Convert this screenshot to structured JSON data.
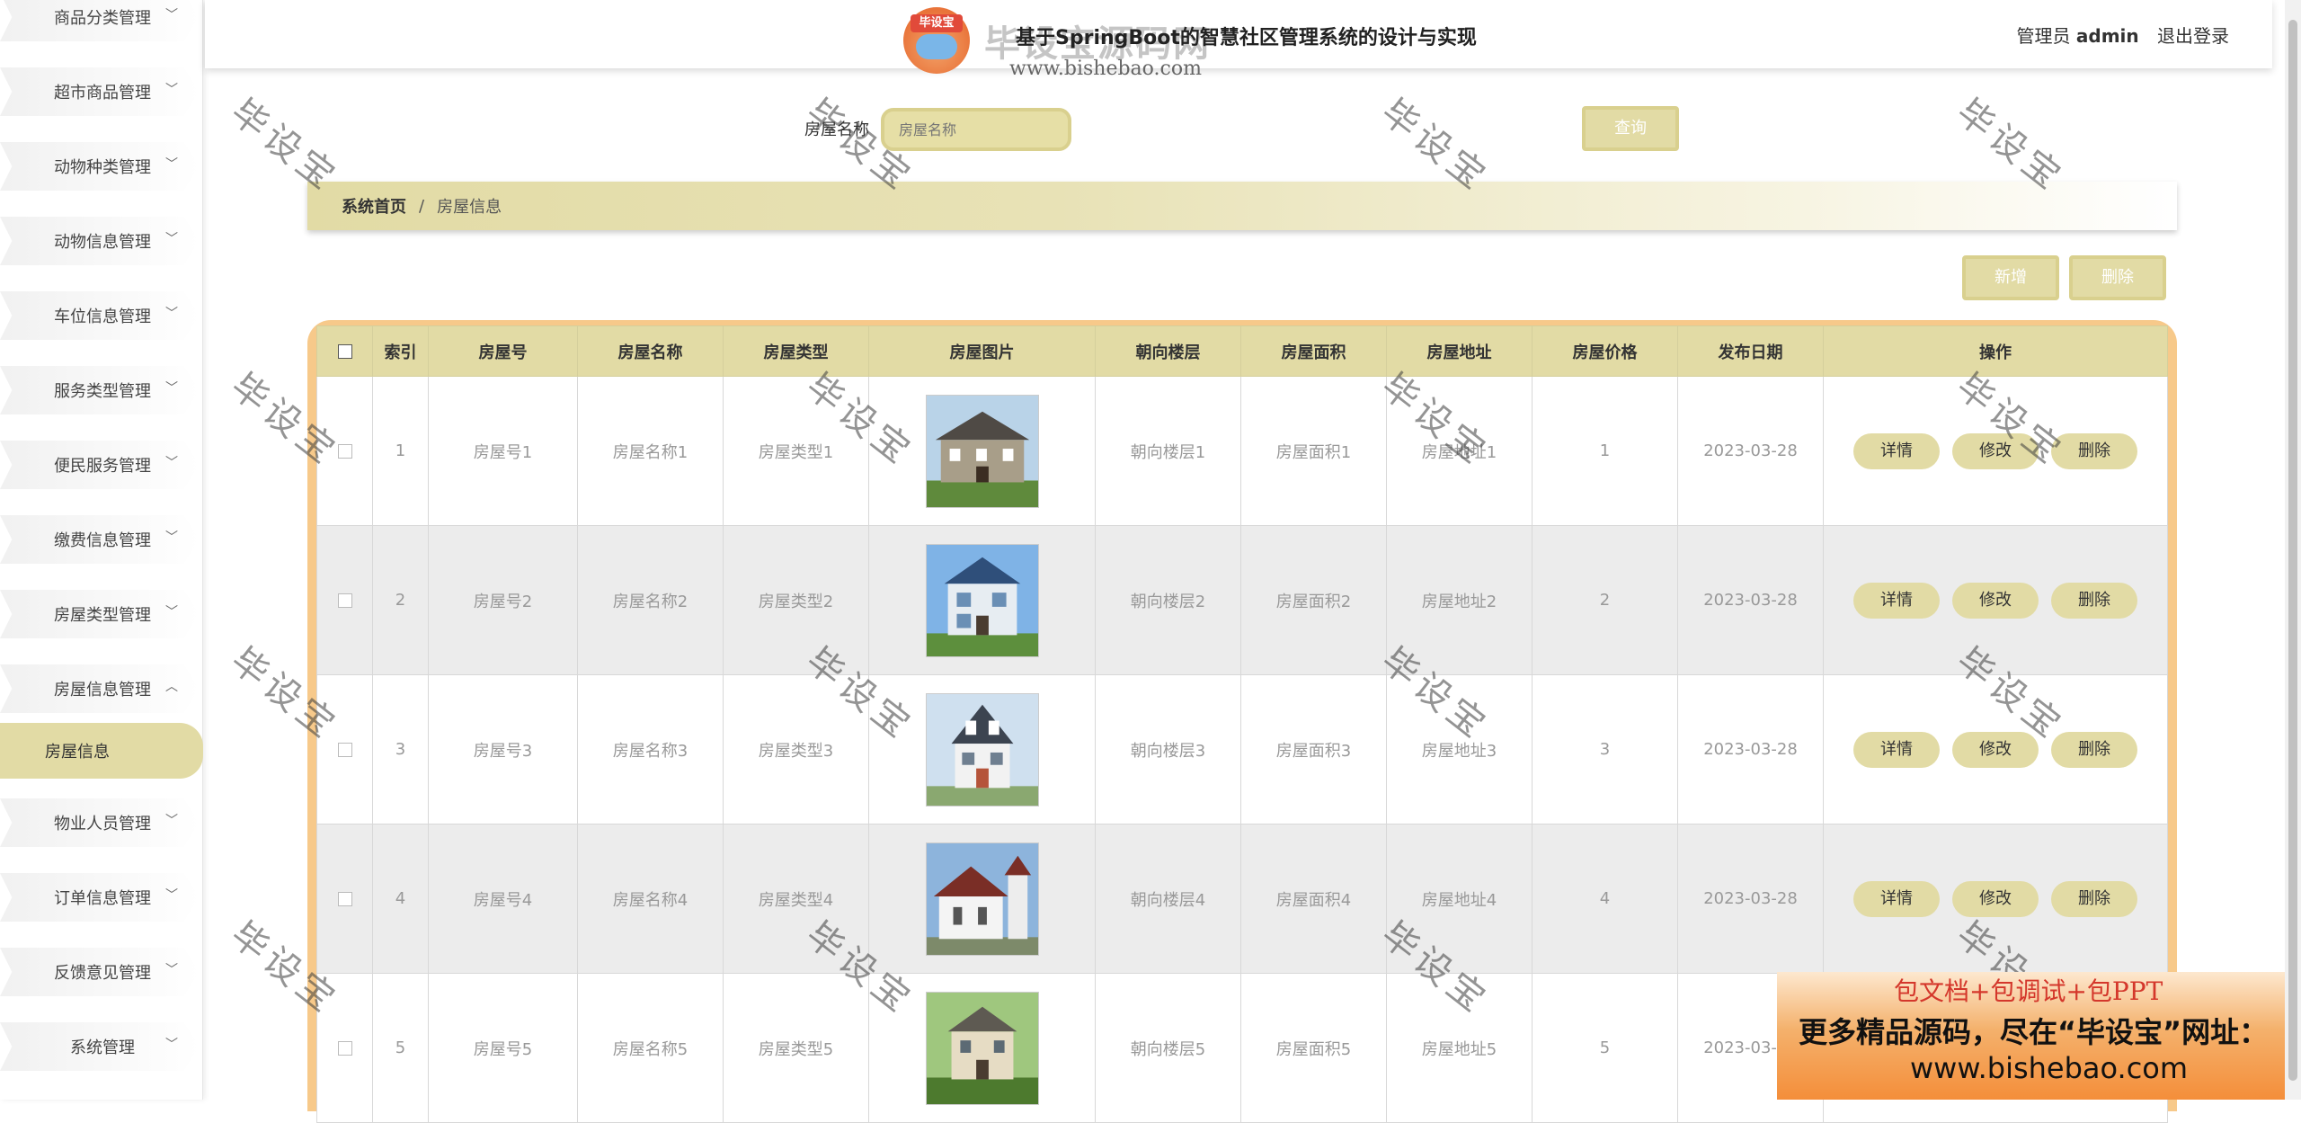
{
  "header": {
    "logo_badge_text": "毕设宝",
    "logo_text": "毕设宝源码网",
    "logo_url": "www.bishebao.com",
    "title": "基于SpringBoot的智慧社区管理系统的设计与实现",
    "admin_role": "管理员",
    "admin_name": "admin",
    "logout": "退出登录"
  },
  "sidebar": {
    "items": [
      {
        "label": "商品分类管理"
      },
      {
        "label": "超市商品管理"
      },
      {
        "label": "动物种类管理"
      },
      {
        "label": "动物信息管理"
      },
      {
        "label": "车位信息管理"
      },
      {
        "label": "服务类型管理"
      },
      {
        "label": "便民服务管理"
      },
      {
        "label": "缴费信息管理"
      },
      {
        "label": "房屋类型管理"
      },
      {
        "label": "房屋信息管理"
      },
      {
        "label": "物业人员管理"
      },
      {
        "label": "订单信息管理"
      },
      {
        "label": "反馈意见管理"
      },
      {
        "label": "系统管理"
      }
    ],
    "active_sub": "房屋信息"
  },
  "search": {
    "label": "房屋名称",
    "placeholder": "房屋名称",
    "button": "查询"
  },
  "breadcrumb": {
    "home": "系统首页",
    "sep": "/",
    "current": "房屋信息"
  },
  "actions": {
    "add": "新增",
    "delete": "删除"
  },
  "table": {
    "columns": [
      "索引",
      "房屋号",
      "房屋名称",
      "房屋类型",
      "房屋图片",
      "朝向楼层",
      "房屋面积",
      "房屋地址",
      "房屋价格",
      "发布日期",
      "操作"
    ],
    "rows": [
      {
        "index": "1",
        "no": "房屋号1",
        "name": "房屋名称1",
        "type": "房屋类型1",
        "floor": "朝向楼层1",
        "area": "房屋面积1",
        "addr": "房屋地址1",
        "price": "1",
        "date": "2023-03-28"
      },
      {
        "index": "2",
        "no": "房屋号2",
        "name": "房屋名称2",
        "type": "房屋类型2",
        "floor": "朝向楼层2",
        "area": "房屋面积2",
        "addr": "房屋地址2",
        "price": "2",
        "date": "2023-03-28"
      },
      {
        "index": "3",
        "no": "房屋号3",
        "name": "房屋名称3",
        "type": "房屋类型3",
        "floor": "朝向楼层3",
        "area": "房屋面积3",
        "addr": "房屋地址3",
        "price": "3",
        "date": "2023-03-28"
      },
      {
        "index": "4",
        "no": "房屋号4",
        "name": "房屋名称4",
        "type": "房屋类型4",
        "floor": "朝向楼层4",
        "area": "房屋面积4",
        "addr": "房屋地址4",
        "price": "4",
        "date": "2023-03-28"
      },
      {
        "index": "5",
        "no": "房屋号5",
        "name": "房屋名称5",
        "type": "房屋类型5",
        "floor": "朝向楼层5",
        "area": "房屋面积5",
        "addr": "房屋地址5",
        "price": "5",
        "date": "2023-03-28"
      }
    ],
    "row_ops": [
      "详情",
      "修改",
      "删除"
    ]
  },
  "watermark": "毕设宝",
  "ad": {
    "line1": "包文档+包调试+包PPT",
    "line2": "更多精品源码，尽在“毕设宝”网址：",
    "line3": "www.bishebao.com"
  },
  "colors": {
    "accent": "#e2dba5",
    "table_frame": "#f7c98a",
    "ad_text": "#d4372b"
  }
}
